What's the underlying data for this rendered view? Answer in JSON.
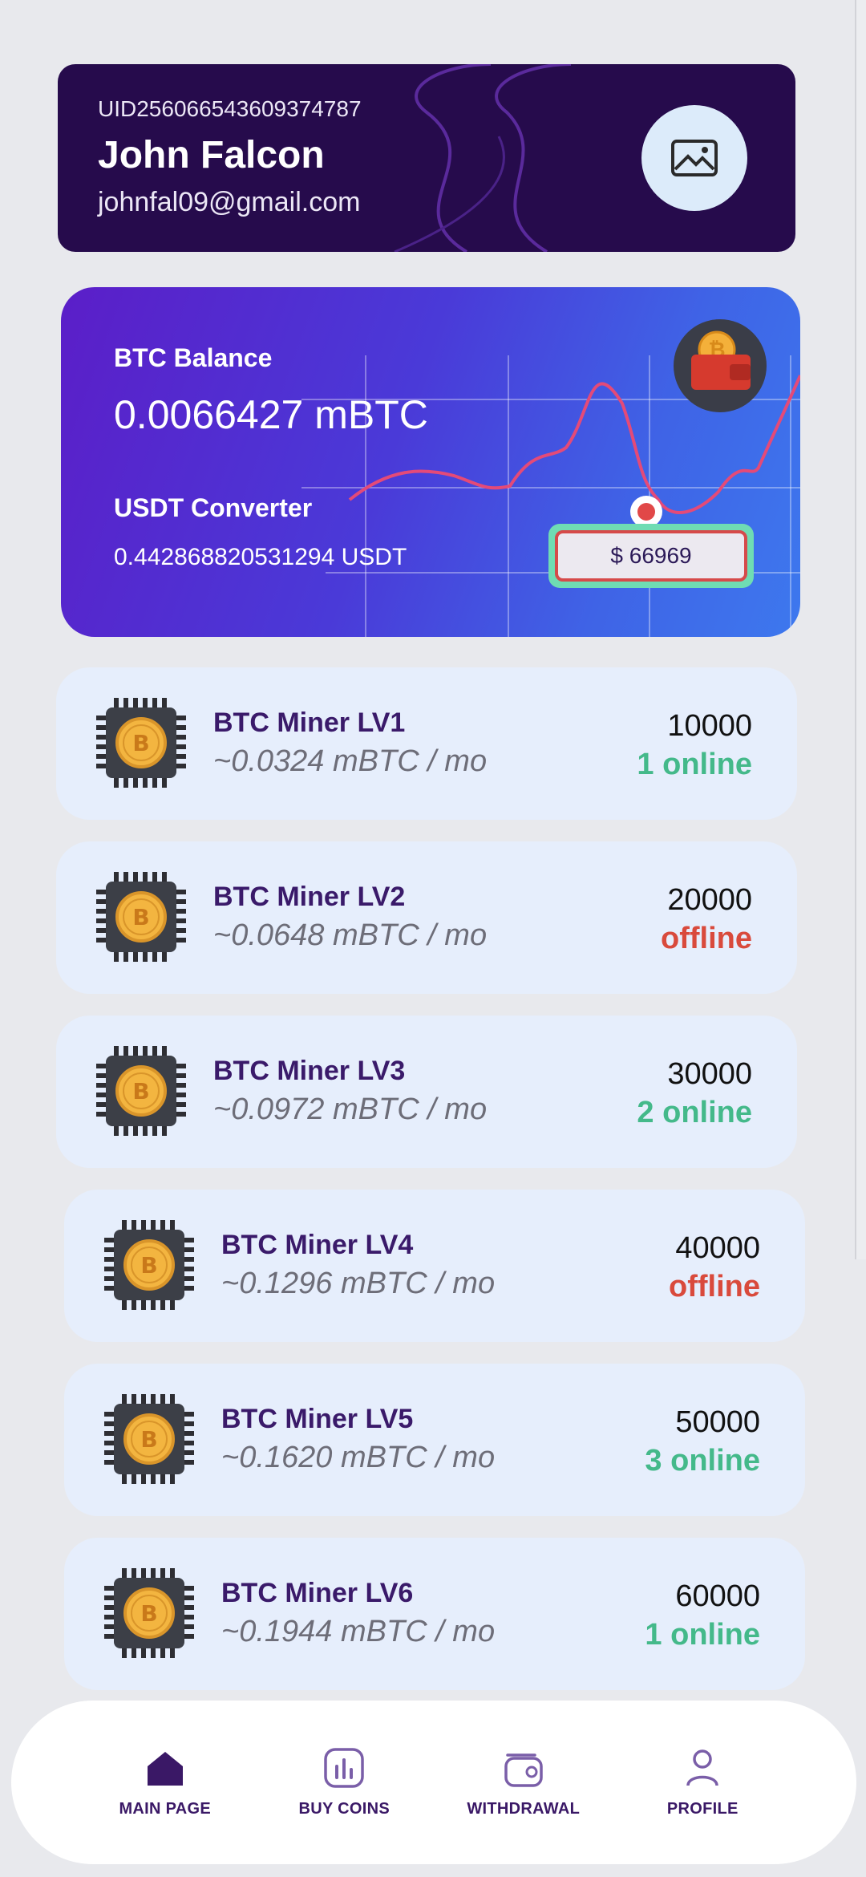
{
  "profile": {
    "uid": "UID256066543609374787",
    "name": "John Falcon",
    "email": "johnfal09@gmail.com",
    "avatar_icon": "image-placeholder-icon"
  },
  "balance": {
    "btc_label": "BTC Balance",
    "btc_value": "0.0066427 mBTC",
    "usdt_label": "USDT Converter",
    "usdt_value": "0.442868820531294 USDT",
    "price_tag": "$ 66969",
    "wallet_icon": "bitcoin-wallet-icon"
  },
  "miners": [
    {
      "name": "BTC Miner LV1",
      "rate": "~0.0324 mBTC / mo",
      "price": "10000",
      "status": "1 online",
      "status_color": "#44b98a"
    },
    {
      "name": "BTC Miner LV2",
      "rate": "~0.0648 mBTC / mo",
      "price": "20000",
      "status": "offline",
      "status_color": "#d94a3c"
    },
    {
      "name": "BTC Miner LV3",
      "rate": "~0.0972 mBTC / mo",
      "price": "30000",
      "status": "2 online",
      "status_color": "#44b98a"
    },
    {
      "name": "BTC Miner LV4",
      "rate": "~0.1296 mBTC / mo",
      "price": "40000",
      "status": "offline",
      "status_color": "#d94a3c"
    },
    {
      "name": "BTC Miner LV5",
      "rate": "~0.1620 mBTC / mo",
      "price": "50000",
      "status": "3 online",
      "status_color": "#44b98a"
    },
    {
      "name": "BTC Miner LV6",
      "rate": "~0.1944 mBTC / mo",
      "price": "60000",
      "status": "1 online",
      "status_color": "#44b98a"
    }
  ],
  "nav": {
    "items": [
      {
        "label": "MAIN PAGE",
        "icon": "home-icon",
        "active": true
      },
      {
        "label": "BUY COINS",
        "icon": "chart-bars-icon",
        "active": false
      },
      {
        "label": "WITHDRAWAL",
        "icon": "wallet-icon",
        "active": false
      },
      {
        "label": "PROFILE",
        "icon": "user-icon",
        "active": false
      }
    ],
    "active_color": "#3a1866",
    "inactive_color": "#3a1866"
  },
  "colors": {
    "online": "#44b98a",
    "offline": "#d94a3c",
    "brand": "#260b4c"
  }
}
